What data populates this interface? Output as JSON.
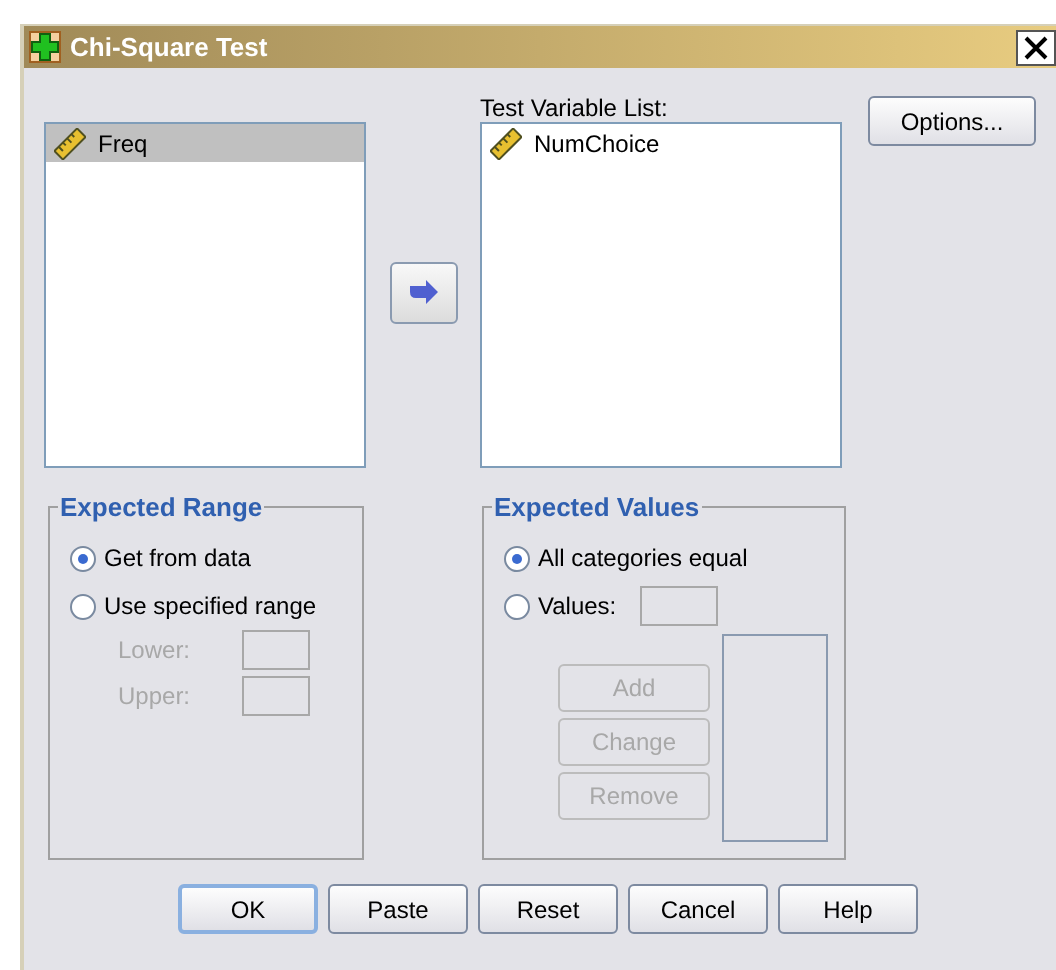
{
  "window": {
    "title": "Chi-Square Test"
  },
  "source_list": {
    "items": [
      {
        "label": "Freq",
        "selected": true
      }
    ]
  },
  "test_variable_list": {
    "label": "Test Variable List:",
    "items": [
      {
        "label": "NumChoice",
        "selected": false
      }
    ]
  },
  "options_button": "Options...",
  "expected_range": {
    "title": "Expected Range",
    "options": [
      {
        "label": "Get from data",
        "selected": true
      },
      {
        "label": "Use specified range",
        "selected": false
      }
    ],
    "fields": [
      {
        "label": "Lower:",
        "disabled": true
      },
      {
        "label": "Upper:",
        "disabled": true
      }
    ]
  },
  "expected_values": {
    "title": "Expected Values",
    "options": [
      {
        "label": "All categories equal",
        "selected": true
      },
      {
        "label": "Values:",
        "selected": false
      }
    ],
    "buttons": [
      {
        "label": "Add",
        "disabled": true
      },
      {
        "label": "Change",
        "disabled": true
      },
      {
        "label": "Remove",
        "disabled": true
      }
    ]
  },
  "buttons": [
    {
      "label": "OK",
      "default": true
    },
    {
      "label": "Paste",
      "default": false
    },
    {
      "label": "Reset",
      "default": false
    },
    {
      "label": "Cancel",
      "default": false
    },
    {
      "label": "Help",
      "default": false
    }
  ]
}
